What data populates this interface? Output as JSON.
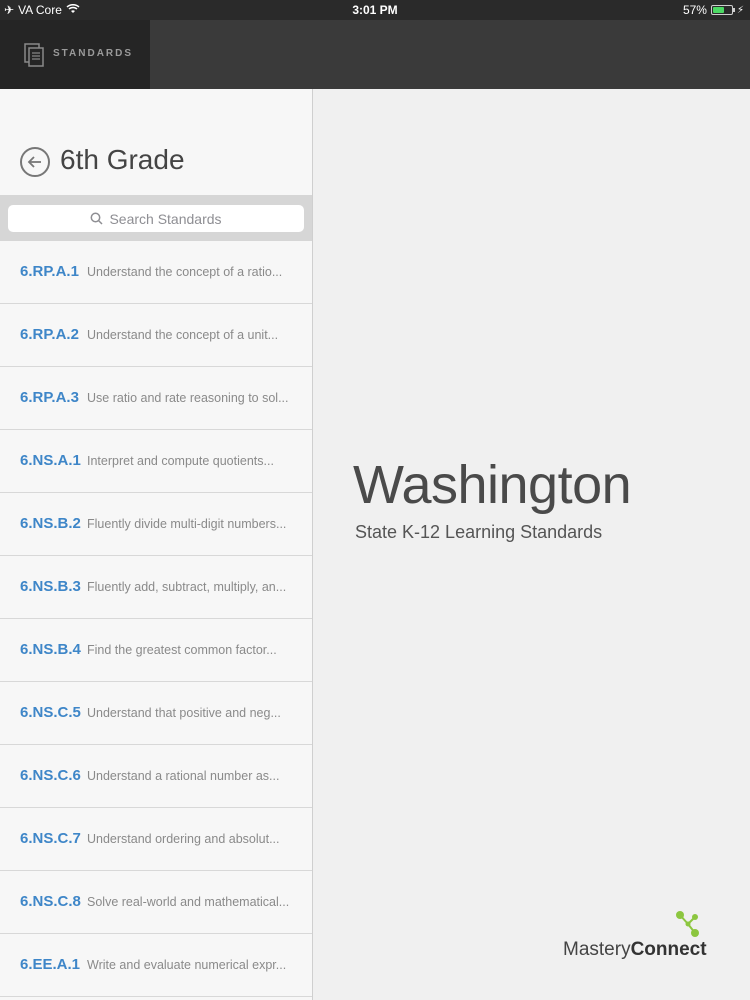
{
  "status_bar": {
    "carrier": "VA Core",
    "time": "3:01 PM",
    "battery": "57%"
  },
  "nav": {
    "tab_label": "STANDARDS"
  },
  "sidebar": {
    "title": "6th Grade",
    "search_placeholder": "Search Standards",
    "items": [
      {
        "code": "6.RP.A.1",
        "desc": "Understand the concept of a ratio..."
      },
      {
        "code": "6.RP.A.2",
        "desc": "Understand the concept of a unit..."
      },
      {
        "code": "6.RP.A.3",
        "desc": "Use ratio and rate reasoning to sol..."
      },
      {
        "code": "6.NS.A.1",
        "desc": "Interpret and compute quotients..."
      },
      {
        "code": "6.NS.B.2",
        "desc": "Fluently divide multi-digit numbers..."
      },
      {
        "code": "6.NS.B.3",
        "desc": "Fluently add, subtract, multiply, an..."
      },
      {
        "code": "6.NS.B.4",
        "desc": "Find the greatest common factor..."
      },
      {
        "code": "6.NS.C.5",
        "desc": "Understand that positive and neg..."
      },
      {
        "code": "6.NS.C.6",
        "desc": "Understand a rational number as..."
      },
      {
        "code": "6.NS.C.7",
        "desc": "Understand ordering and absolut..."
      },
      {
        "code": "6.NS.C.8",
        "desc": "Solve real-world and mathematical..."
      },
      {
        "code": "6.EE.A.1",
        "desc": "Write and evaluate numerical expr..."
      }
    ]
  },
  "main": {
    "title": "Washington",
    "subtitle": "State K-12 Learning Standards"
  },
  "logo": {
    "text_light": "Mastery",
    "text_bold": "Connect"
  },
  "colors": {
    "accent": "#3e86c8",
    "logo_green": "#8cc63f"
  }
}
